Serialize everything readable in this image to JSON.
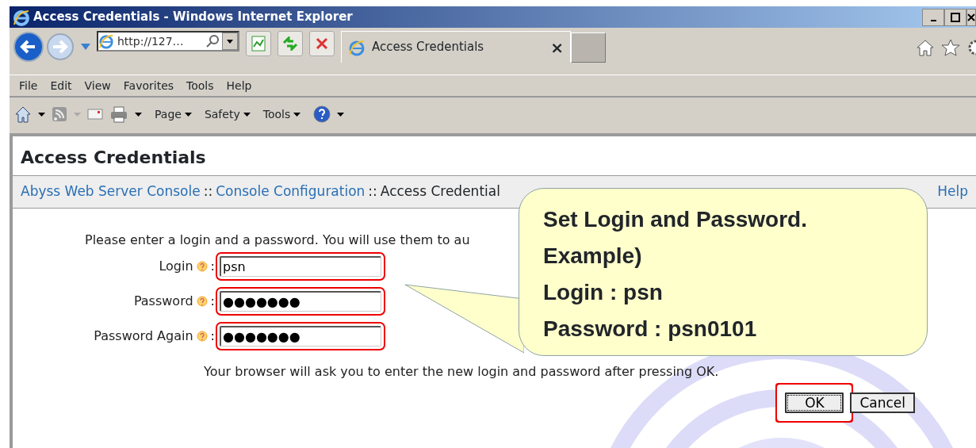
{
  "window": {
    "title": "Access Credentials - Windows Internet Explorer"
  },
  "address_bar": {
    "url": "http://127…"
  },
  "tabs": [
    {
      "label": "Access Credentials",
      "selected": true,
      "close": "×"
    }
  ],
  "menu_bar": [
    "File",
    "Edit",
    "View",
    "Favorites",
    "Tools",
    "Help"
  ],
  "command_bar": {
    "menus": [
      "Page",
      "Safety",
      "Tools"
    ]
  },
  "page": {
    "heading": "Access Credentials",
    "breadcrumb": [
      {
        "kind": "link",
        "label": "Abyss Web Server Console"
      },
      {
        "kind": "separator",
        "label": "::"
      },
      {
        "kind": "link",
        "label": "Console Configuration"
      },
      {
        "kind": "separator",
        "label": "::"
      },
      {
        "kind": "current",
        "label": "Access Credential"
      }
    ],
    "help_link": "Help",
    "intro": "Please enter a login and a password. You will use them to au",
    "fields": [
      {
        "label": "Login",
        "separator": ":",
        "value": "psn",
        "highlighted": true
      },
      {
        "label": "Password",
        "separator": ":",
        "value": "●●●●●●●",
        "highlighted": true
      },
      {
        "label": "Password Again",
        "separator": ":",
        "value": "●●●●●●●",
        "highlighted": true
      }
    ],
    "note": "Your browser will ask you to enter the new login and password after pressing OK.",
    "buttons": [
      {
        "label": "OK",
        "focused": true,
        "highlighted": true
      },
      {
        "label": "Cancel",
        "focused": false,
        "highlighted": false
      }
    ]
  },
  "callout": {
    "lines": [
      "Set Login and Password.",
      "Example)",
      "Login : psn",
      "Password : psn0101"
    ]
  }
}
